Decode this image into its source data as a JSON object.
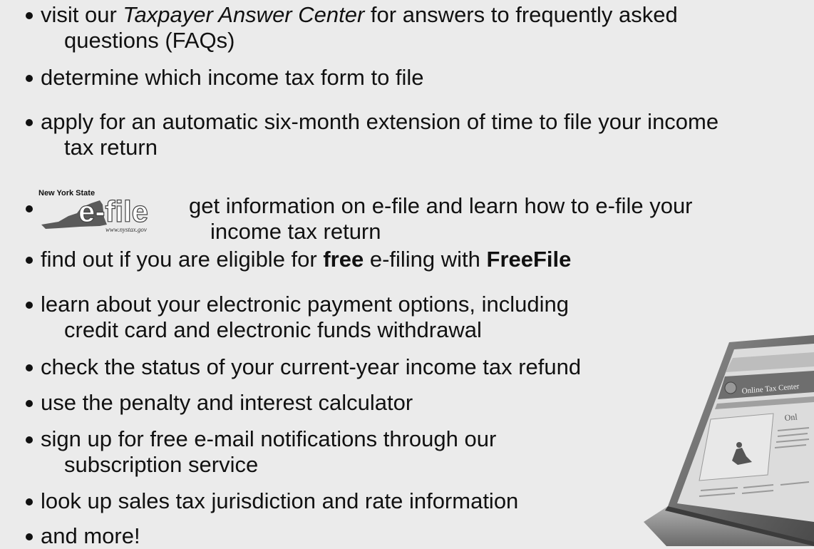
{
  "items": [
    {
      "lines": [
        {
          "parts": [
            {
              "t": "visit our "
            },
            {
              "t": "Taxpayer Answer Center",
              "style": "italic"
            },
            {
              "t": " for answers to frequently asked"
            }
          ]
        },
        {
          "parts": [
            {
              "t": "questions (FAQs)"
            }
          ]
        }
      ]
    },
    {
      "lines": [
        {
          "parts": [
            {
              "t": "determine which income tax form to file"
            }
          ]
        }
      ]
    },
    {
      "lines": [
        {
          "parts": [
            {
              "t": "apply for an automatic six-month extension of time to file your income"
            }
          ]
        },
        {
          "parts": [
            {
              "t": "tax return"
            }
          ]
        }
      ]
    },
    {
      "lines": [
        {
          "parts": [
            {
              "t": "get information on e-file and learn how to e-file your"
            }
          ]
        },
        {
          "parts": [
            {
              "t": "income tax return"
            }
          ]
        }
      ]
    },
    {
      "lines": [
        {
          "parts": [
            {
              "t": "find out if you are eligible for "
            },
            {
              "t": "free",
              "style": "bold"
            },
            {
              "t": " e-filing with "
            },
            {
              "t": "FreeFile",
              "style": "bold"
            }
          ]
        }
      ]
    },
    {
      "lines": [
        {
          "parts": [
            {
              "t": "learn about your electronic payment options, including"
            }
          ]
        },
        {
          "parts": [
            {
              "t": "credit card and electronic funds withdrawal"
            }
          ]
        }
      ]
    },
    {
      "lines": [
        {
          "parts": [
            {
              "t": "check the status of your current-year income tax refund"
            }
          ]
        }
      ]
    },
    {
      "lines": [
        {
          "parts": [
            {
              "t": "use the penalty and interest calculator"
            }
          ]
        }
      ]
    },
    {
      "lines": [
        {
          "parts": [
            {
              "t": "sign up for free e-mail notifications through our"
            }
          ]
        },
        {
          "parts": [
            {
              "t": "subscription service"
            }
          ]
        }
      ]
    },
    {
      "lines": [
        {
          "parts": [
            {
              "t": "look up sales tax jurisdiction and rate information"
            }
          ]
        }
      ]
    },
    {
      "lines": [
        {
          "parts": [
            {
              "t": "and more!"
            }
          ]
        }
      ]
    }
  ],
  "efile_logo": {
    "title": "New York State",
    "mark": "e-file",
    "url": "www.nystax.gov"
  },
  "laptop": {
    "screen_title": "Online Tax Center",
    "heading": "Onl"
  }
}
